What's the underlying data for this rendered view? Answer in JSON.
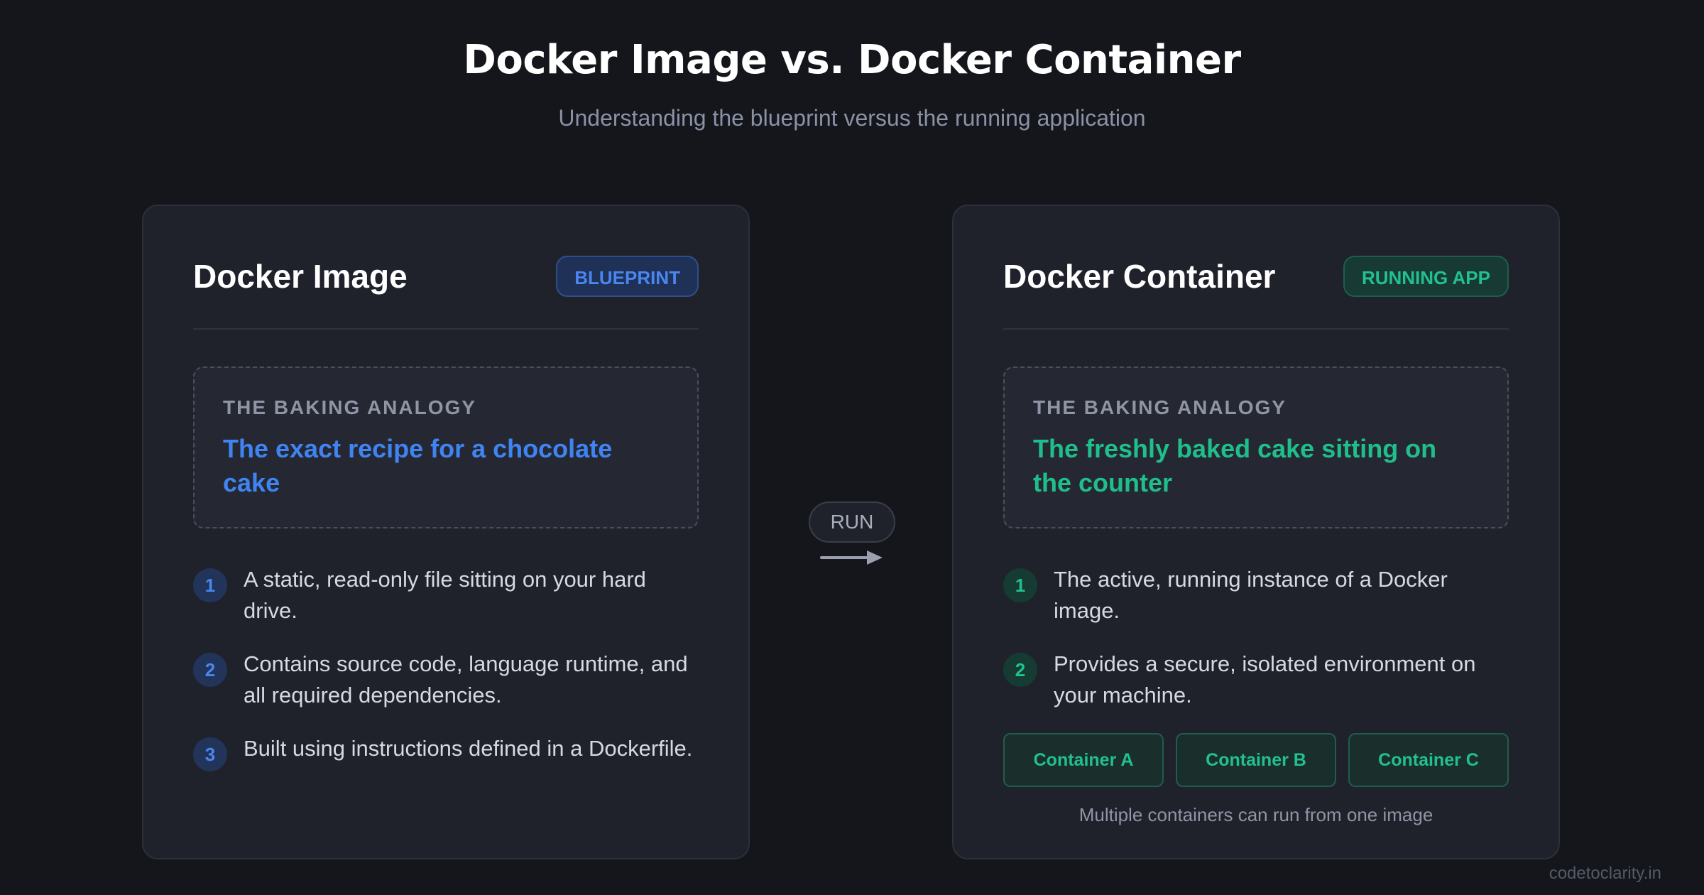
{
  "header": {
    "title": "Docker Image vs. Docker Container",
    "subtitle": "Understanding the blueprint versus the running application"
  },
  "image_card": {
    "title": "Docker Image",
    "badge": "BLUEPRINT",
    "analogy_label": "THE BAKING ANALOGY",
    "analogy_text": "The exact recipe for a chocolate cake",
    "points": [
      {
        "num": "1",
        "text": "A static, read-only file sitting on your hard drive."
      },
      {
        "num": "2",
        "text": "Contains source code, language runtime, and all required dependencies."
      },
      {
        "num": "3",
        "text": "Built using instructions defined in a Dockerfile."
      }
    ]
  },
  "connector": {
    "label": "RUN"
  },
  "container_card": {
    "title": "Docker Container",
    "badge": "RUNNING APP",
    "analogy_label": "THE BAKING ANALOGY",
    "analogy_text": "The freshly baked cake sitting on the counter",
    "points": [
      {
        "num": "1",
        "text": "The active, running instance of a Docker image."
      },
      {
        "num": "2",
        "text": "Provides a secure, isolated environment on your machine."
      }
    ],
    "containers": [
      "Container A",
      "Container B",
      "Container C"
    ],
    "containers_caption": "Multiple containers can run from one image"
  },
  "footer": {
    "watermark": "codetoclarity.in"
  },
  "colors": {
    "background": "#14161c",
    "card": "#1f222b",
    "blue_accent": "#3f84f2",
    "green_accent": "#1fbf8c"
  }
}
